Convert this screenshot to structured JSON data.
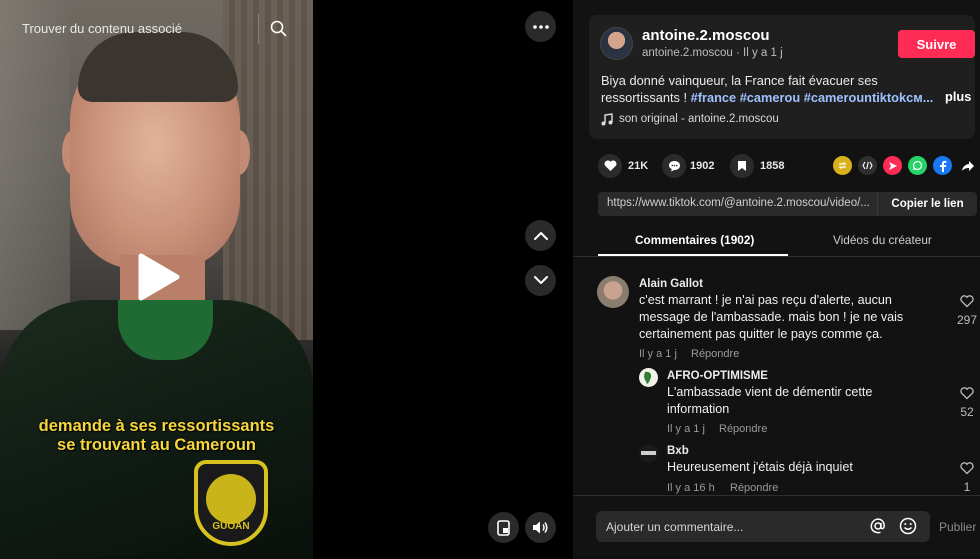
{
  "video": {
    "search_label": "Trouver du contenu associé",
    "caption_line1": "demande à ses ressortissants",
    "caption_line2": "se trouvant au Cameroun",
    "badge_text": "GUOAN",
    "caption_color": "#f5d63c"
  },
  "author": {
    "name": "antoine.2.moscou",
    "sub": "antoine.2.moscou · Il y a 1 j",
    "follow_label": "Suivre"
  },
  "description": {
    "text": "Biya donné vainqueur, la France fait évacuer ses ressortissants ! ",
    "tags": "#france #camerou #camerountiktokᴄᴍ...",
    "more_label": "plus",
    "music": "son original - antoine.2.moscou"
  },
  "stats": {
    "likes": "21K",
    "comments": "1902",
    "saves": "1858"
  },
  "share": {
    "url": "https://www.tiktok.com/@antoine.2.moscou/video/...",
    "copy_label": "Copier le lien"
  },
  "tabs": {
    "comments": "Commentaires (1902)",
    "creator_videos": "Vidéos du créateur"
  },
  "comments": [
    {
      "name": "Alain Gallot",
      "lines": [
        "c'est marrant ! je n'ai pas reçu d'alerte, aucun",
        "message de l'ambassade. mais bon ! je ne vais",
        "certainement pas quitter le pays comme ça."
      ],
      "time": "Il y a 1 j",
      "reply": "Répondre",
      "likes": "297"
    },
    {
      "name": "AFRO-OPTIMISME",
      "lines": [
        "L'ambassade vient de démentir cette",
        "information"
      ],
      "time": "Il y a 1 j",
      "reply": "Répondre",
      "likes": "52"
    },
    {
      "name": "Bxb",
      "lines": [
        "Heureusement j'étais déjà inquiet"
      ],
      "time": "Il y a 16 h",
      "reply": "Répondre",
      "likes": "1"
    }
  ],
  "composer": {
    "placeholder": "Ajouter un commentaire...",
    "publish_label": "Publier"
  },
  "colors": {
    "accent": "#fe2c55",
    "tag": "#9fc2ff",
    "panel": "#121212"
  }
}
